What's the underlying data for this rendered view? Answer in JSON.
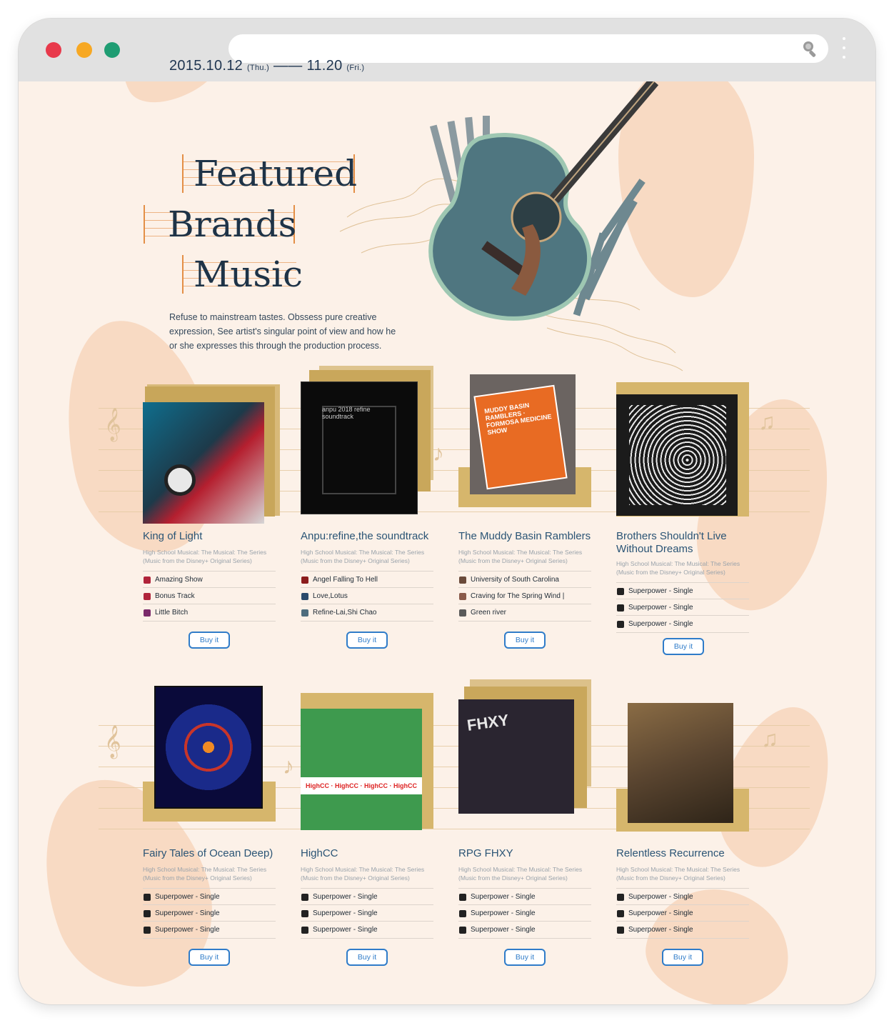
{
  "browser": {
    "dots": [
      "#e8394b",
      "#f7a823",
      "#1f9d73"
    ],
    "url_value": ""
  },
  "hero": {
    "date_start": "2015.10.12",
    "date_start_day": "(Thu.)",
    "dash": "——",
    "date_end": "11.20",
    "date_end_day": "(Fri.)",
    "title_lines": [
      "Featured",
      "Brands",
      "Music"
    ],
    "description": "Refuse to mainstream tastes. Obssess pure creative expression, See artist's singular point of view and how he or she expresses this through the production process."
  },
  "cards": [
    {
      "title": "King of Light",
      "subtitle": "High School Musical: The Musical: The Series (Music from the Disney+ Original Series)",
      "tracks": [
        "Amazing Show",
        "Bonus Track",
        "Little Bitch"
      ],
      "buy_label": "Buy it"
    },
    {
      "title": "Anpu:refine,the soundtrack",
      "subtitle": "High School Musical: The Musical: The Series (Music from the Disney+ Original Series)",
      "tracks": [
        "Angel Falling To Hell",
        "Love,Lotus",
        "Refine-Lai,Shi Chao"
      ],
      "buy_label": "Buy it",
      "cover_text": "anpu 2018 refine soundtrack"
    },
    {
      "title": "The Muddy Basin Ramblers",
      "subtitle": "High School Musical: The Musical: The Series (Music from the Disney+ Original Series)",
      "tracks": [
        "University of South Carolina",
        "Craving for The Spring Wind |",
        "Green river"
      ],
      "buy_label": "Buy it",
      "cover_text": "MUDDY BASIN RAMBLERS · FORMOSA MEDICINE SHOW"
    },
    {
      "title": "Brothers Shouldn't Live Without Dreams",
      "subtitle": "High School Musical: The Musical: The Series (Music from the Disney+ Original Series)",
      "tracks": [
        "Superpower - Single",
        "Superpower - Single",
        "Superpower - Single"
      ],
      "buy_label": "Buy it"
    },
    {
      "title": "Fairy Tales of Ocean Deep)",
      "subtitle": "High School Musical: The Musical: The Series (Music from the Disney+ Original Series)",
      "tracks": [
        "Superpower - Single",
        "Superpower - Single",
        "Superpower - Single"
      ],
      "buy_label": "Buy it"
    },
    {
      "title": "HighCC",
      "subtitle": "High School Musical: The Musical: The Series (Music from the Disney+ Original Series)",
      "tracks": [
        "Superpower - Single",
        "Superpower - Single",
        "Superpower - Single"
      ],
      "buy_label": "Buy it",
      "cover_text": "HighCC · HighCC · HighCC · HighCC"
    },
    {
      "title": "RPG FHXY",
      "subtitle": "High School Musical: The Musical: The Series (Music from the Disney+ Original Series)",
      "tracks": [
        "Superpower - Single",
        "Superpower - Single",
        "Superpower - Single"
      ],
      "buy_label": "Buy it",
      "cover_text": "FHXY"
    },
    {
      "title": "Relentless Recurrence",
      "subtitle": "High School Musical: The Musical: The Series (Music from the Disney+ Original Series)",
      "tracks": [
        "Superpower - Single",
        "Superpower - Single",
        "Superpower - Single"
      ],
      "buy_label": "Buy it"
    }
  ],
  "colors": {
    "accent": "#2f7cc9",
    "title": "#2a5475",
    "background": "#fcf1e8",
    "stack_gold": "#cfa94e",
    "staff": "#e4c9a2"
  }
}
